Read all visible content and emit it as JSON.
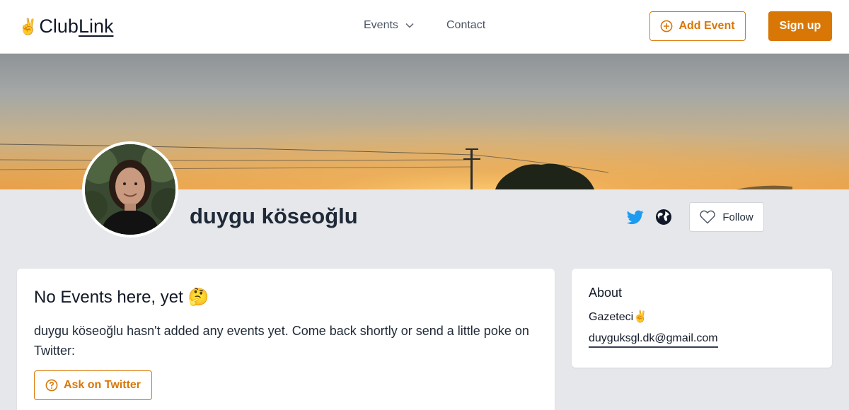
{
  "header": {
    "logo_part1": "Club",
    "logo_part2": "Link",
    "logo_emoji": "✌️",
    "nav": {
      "events_label": "Events",
      "contact_label": "Contact"
    },
    "add_event_label": "Add Event",
    "sign_up_label": "Sign up"
  },
  "profile": {
    "name": "duygu köseoğlu",
    "follow_label": "Follow",
    "icons": [
      "twitter-icon",
      "globe-icon",
      "heart-icon"
    ]
  },
  "events_card": {
    "title": "No Events here, yet 🤔",
    "message": "duygu köseoğlu hasn't added any events yet. Come back shortly or send a little poke on Twitter:",
    "ask_label": "Ask on Twitter"
  },
  "about_card": {
    "title": "About",
    "bio": "Gazeteci✌️",
    "email": "duyguksgl.dk@gmail.com"
  },
  "colors": {
    "accent": "#d97706",
    "twitter": "#1d9bf0",
    "page_bg": "#e5e7eb"
  }
}
